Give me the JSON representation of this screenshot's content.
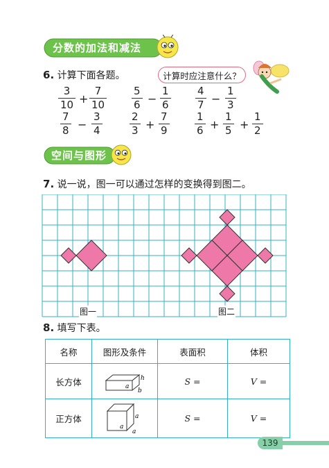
{
  "section1": {
    "title": "分数的加法和减法"
  },
  "q6": {
    "number": "6",
    "text": "计算下面各题。",
    "bubble": "计算时应注意什么？",
    "row1": [
      {
        "a": [
          "3",
          "10"
        ],
        "op": "+",
        "b": [
          "7",
          "10"
        ]
      },
      {
        "a": [
          "5",
          "6"
        ],
        "op": "−",
        "b": [
          "1",
          "6"
        ]
      },
      {
        "a": [
          "4",
          "7"
        ],
        "op": "−",
        "b": [
          "1",
          "3"
        ]
      }
    ],
    "row2": [
      {
        "a": [
          "7",
          "8"
        ],
        "op": "−",
        "b": [
          "3",
          "4"
        ]
      },
      {
        "a": [
          "2",
          "3"
        ],
        "op": "+",
        "b": [
          "7",
          "9"
        ]
      },
      {
        "terms": [
          [
            "1",
            "6"
          ],
          [
            "1",
            "5"
          ],
          [
            "1",
            "2"
          ]
        ],
        "ops": [
          "+",
          "+"
        ]
      }
    ]
  },
  "section2": {
    "title": "空间与图形"
  },
  "q7": {
    "number": "7",
    "text": "说一说，图一可以通过怎样的变换得到图二。",
    "fig1": "图一",
    "fig2": "图二"
  },
  "q8": {
    "number": "8",
    "text": "填写下表。",
    "headers": [
      "名称",
      "图形及条件",
      "表面积",
      "体积"
    ],
    "rows": [
      {
        "name": "长方体",
        "labels": [
          "a",
          "h",
          "b"
        ],
        "area": "S =",
        "volume": "V ="
      },
      {
        "name": "正方体",
        "labels": [
          "a",
          "a",
          "a"
        ],
        "area": "S =",
        "volume": "V ="
      }
    ]
  },
  "page_number": "139",
  "colors": {
    "banner_green": "#6cc24a",
    "grid_blue": "#33b0c4",
    "pink": "#ee79a9",
    "tab_green": "#86cfa8"
  }
}
